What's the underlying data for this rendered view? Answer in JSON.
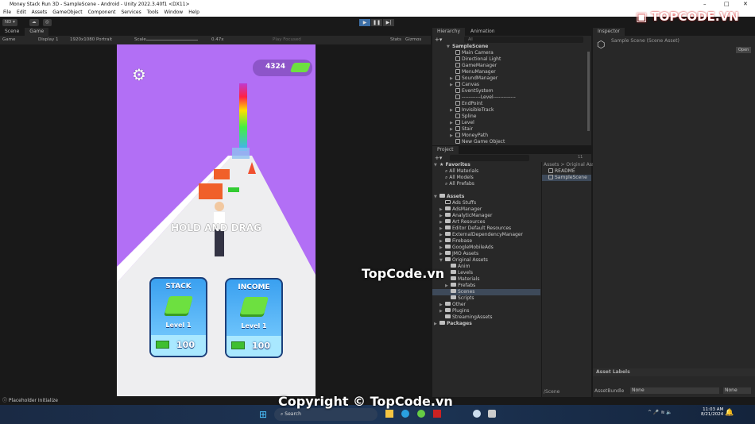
{
  "window": {
    "title": "Money Stack Run 3D - SampleScene - Android - Unity 2022.3.40f1 <DX11>",
    "minimize": "–",
    "maximize": "□",
    "close": "✕"
  },
  "menu": [
    "File",
    "Edit",
    "Assets",
    "GameObject",
    "Component",
    "Services",
    "Tools",
    "Window",
    "Help"
  ],
  "toolbar": {
    "account": "ND ▾",
    "play_icon": "▶",
    "pause_icon": "❚❚",
    "step_icon": "▶|"
  },
  "scene_tabs": {
    "scene": "Scene",
    "game": "Game"
  },
  "game_toolbar": {
    "mode": "Game",
    "display": "Display 1",
    "resolution": "1920x1080 Portrait",
    "scale_label": "Scale",
    "scale_value": "0.47x",
    "play_focused": "Play Focused",
    "stats": "Stats",
    "gizmos": "Gizmos"
  },
  "game": {
    "coins": "4324",
    "hint": "HOLD AND DRAG",
    "cards": [
      {
        "title": "STACK",
        "level": "Level 1",
        "price": "100"
      },
      {
        "title": "INCOME",
        "level": "Level 1",
        "price": "100"
      }
    ],
    "colors": {
      "sky": "#b26ff5",
      "card": "#3aa0f0"
    }
  },
  "hierarchy": {
    "tabs": [
      "Hierarchy",
      "Animation"
    ],
    "search_placeholder": "All",
    "scene": "SampleScene",
    "items": [
      {
        "label": "Main Camera",
        "expand": false
      },
      {
        "label": "Directional Light",
        "expand": false
      },
      {
        "label": "GameManager",
        "expand": false
      },
      {
        "label": "MenuManager",
        "expand": false
      },
      {
        "label": "SoundManager",
        "expand": true
      },
      {
        "label": "Canvas",
        "expand": true
      },
      {
        "label": "EventSystem",
        "expand": false
      },
      {
        "label": "-----------Level-------------",
        "expand": false
      },
      {
        "label": "EndPoint",
        "expand": false
      },
      {
        "label": "InvisibleTrack",
        "expand": true
      },
      {
        "label": "Spline",
        "expand": false
      },
      {
        "label": "Level",
        "expand": true
      },
      {
        "label": "Stair",
        "expand": true
      },
      {
        "label": "MoneyPath",
        "expand": true
      },
      {
        "label": "New Game Object",
        "expand": false
      }
    ]
  },
  "project": {
    "tab": "Project",
    "hidden_count": "11",
    "favorites": {
      "label": "Favorites",
      "items": [
        "All Materials",
        "All Models",
        "All Prefabs"
      ]
    },
    "assets": {
      "label": "Assets",
      "items": [
        {
          "label": "Ads Stuffs",
          "depth": 1,
          "expand": false,
          "empty": true
        },
        {
          "label": "AdsManager",
          "depth": 1,
          "expand": true
        },
        {
          "label": "AnalyticManager",
          "depth": 1,
          "expand": true
        },
        {
          "label": "Art Resources",
          "depth": 1,
          "expand": true
        },
        {
          "label": "Editor Default Resources",
          "depth": 1,
          "expand": true
        },
        {
          "label": "ExternalDependencyManager",
          "depth": 1,
          "expand": true
        },
        {
          "label": "Firebase",
          "depth": 1,
          "expand": true
        },
        {
          "label": "GoogleMobileAds",
          "depth": 1,
          "expand": true
        },
        {
          "label": "JMO Assets",
          "depth": 1,
          "expand": true
        },
        {
          "label": "Original Assets",
          "depth": 1,
          "expand": true,
          "open": true
        },
        {
          "label": "Anim",
          "depth": 2,
          "expand": false
        },
        {
          "label": "Levels",
          "depth": 2,
          "expand": false
        },
        {
          "label": "Materials",
          "depth": 2,
          "expand": false
        },
        {
          "label": "Prefabs",
          "depth": 2,
          "expand": true
        },
        {
          "label": "Scenes",
          "depth": 2,
          "expand": false,
          "selected": true
        },
        {
          "label": "Scripts",
          "depth": 2,
          "expand": false
        },
        {
          "label": "Other",
          "depth": 1,
          "expand": true
        },
        {
          "label": "Plugins",
          "depth": 1,
          "expand": true
        },
        {
          "label": "StreamingAssets",
          "depth": 1,
          "expand": false
        }
      ]
    },
    "packages": "Packages",
    "breadcrumb": "Assets > Original Asse",
    "files": [
      {
        "label": "README",
        "selected": false
      },
      {
        "label": "SampleScene",
        "selected": true
      }
    ],
    "path": "/Scene"
  },
  "inspector": {
    "tab": "Inspector",
    "asset_title": "Sample Scene (Scene Asset)",
    "open_button": "Open",
    "asset_labels": "Asset Labels",
    "asset_bundle_label": "AssetBundle",
    "asset_bundle_value": "None",
    "variant_value": "None"
  },
  "status": {
    "message": "Placeholder Initialize"
  },
  "taskbar": {
    "search": "Search",
    "time": "11:03 AM",
    "date": "8/21/2024"
  },
  "watermarks": {
    "logo": "TOPCODE.VN",
    "center": "TopCode.vn",
    "copyright": "Copyright © TopCode.vn"
  }
}
